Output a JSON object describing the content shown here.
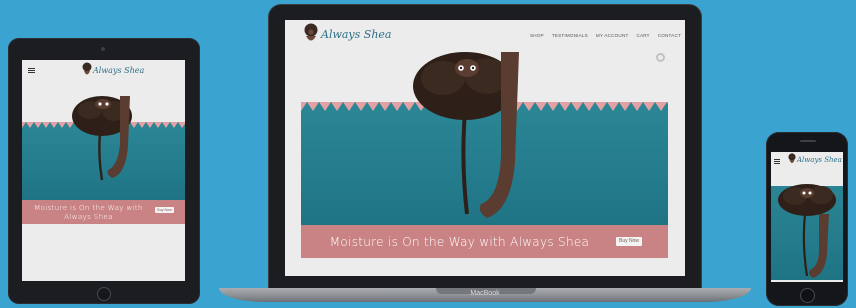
{
  "site": {
    "brand": "Always Shea",
    "nav": [
      "SHOP",
      "TESTIMONIALS",
      "MY ACCOUNT",
      "CART",
      "CONTACT"
    ],
    "hero": {
      "tagline": "Moisture is On the Way with Always Shea",
      "cta": "Buy Now"
    }
  },
  "devices": {
    "tablet": {
      "tagline": "Moisture is On the Way with Always Shea"
    },
    "laptop": {
      "brand_label": "MacBook"
    },
    "phone": {}
  },
  "colors": {
    "background": "#3aa3d0",
    "teal": "#237d8d",
    "pink_band": "#c98384",
    "zigzag": "#e3a1a6",
    "skin": "#5a3c31",
    "hair": "#2e2018"
  },
  "icons": [
    "hamburger-menu-icon",
    "loading-spinner-icon",
    "logo-figure-icon",
    "home-button-icon",
    "camera-icon"
  ]
}
